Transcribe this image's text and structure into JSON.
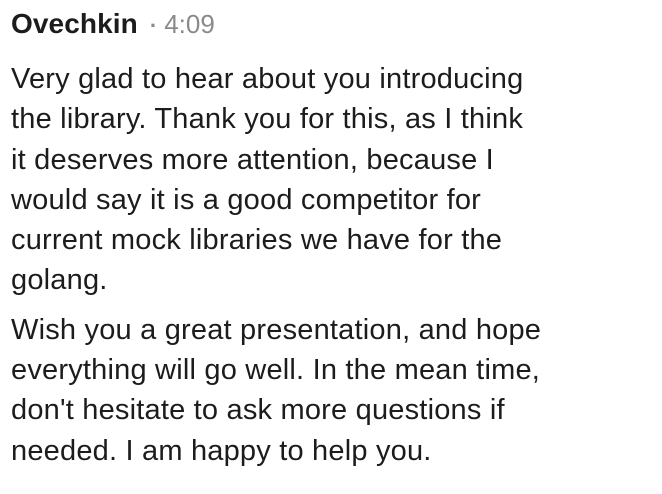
{
  "message": {
    "author": "Ovechkin",
    "separator": "·",
    "timestamp": "4:09",
    "paragraphs": [
      {
        "lines": [
          "Very glad to hear about you introducing",
          "the library. Thank you for this, as I think",
          "it deserves more attention, because I",
          "would say it is a good competitor for",
          "current mock libraries we have for the",
          "golang."
        ]
      },
      {
        "lines": [
          "Wish you a great presentation, and hope",
          "everything will go well. In the mean time,",
          "don't hesitate to ask more questions if",
          "needed. I am happy to help you."
        ]
      }
    ]
  }
}
